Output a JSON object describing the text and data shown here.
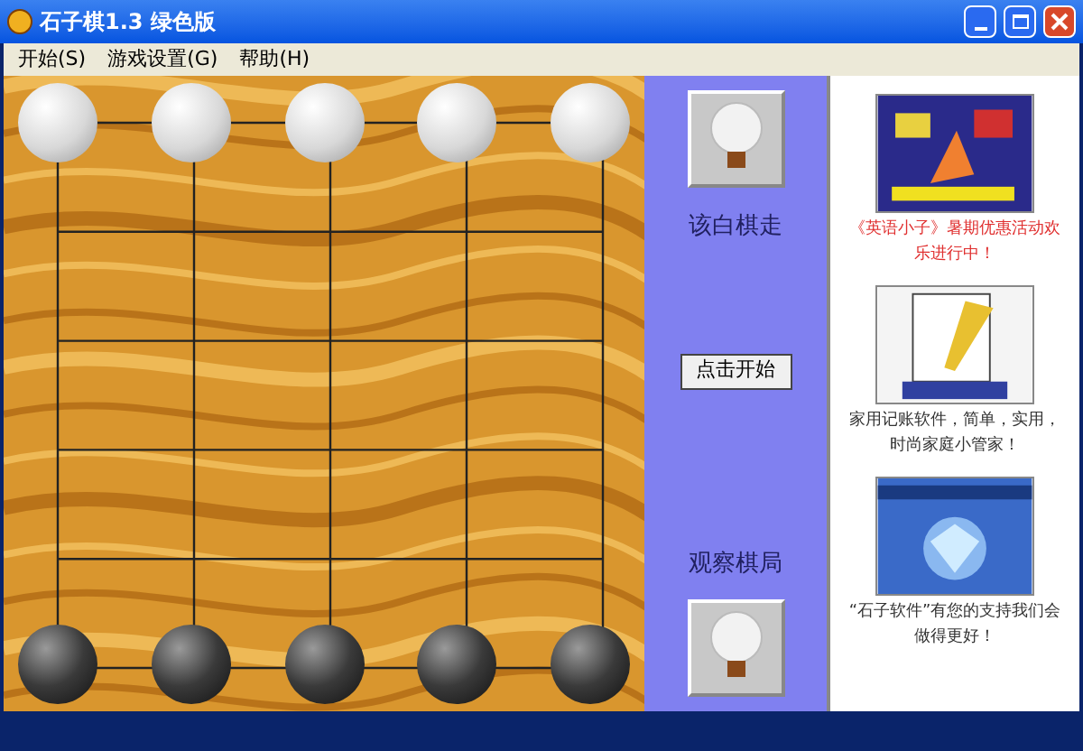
{
  "window": {
    "title": "石子棋1.3 绿色版"
  },
  "menu": [
    {
      "label": "开始(S)"
    },
    {
      "label": "游戏设置(G)"
    },
    {
      "label": "帮助(H)"
    }
  ],
  "board": {
    "top_row": [
      {
        "kind": "white"
      },
      {
        "kind": "white"
      },
      {
        "kind": "white"
      },
      {
        "kind": "white"
      },
      {
        "kind": "white"
      }
    ],
    "bottom_row": [
      {
        "kind": "black"
      },
      {
        "kind": "black"
      },
      {
        "kind": "black"
      },
      {
        "kind": "black"
      },
      {
        "kind": "black"
      }
    ]
  },
  "side": {
    "turn_text": "该白棋走",
    "start_button": "点击开始",
    "watch_text": "观察棋局"
  },
  "ads": [
    {
      "caption": "《英语小子》暑期优惠活动欢乐进行中！",
      "color": "#e03030",
      "kind": "game"
    },
    {
      "caption": "家用记账软件，简单，实用，时尚家庭小管家！",
      "color": "#333333",
      "kind": "notebook"
    },
    {
      "caption": "“石子软件”有您的支持我们会做得更好！",
      "color": "#333333",
      "kind": "gem"
    }
  ]
}
